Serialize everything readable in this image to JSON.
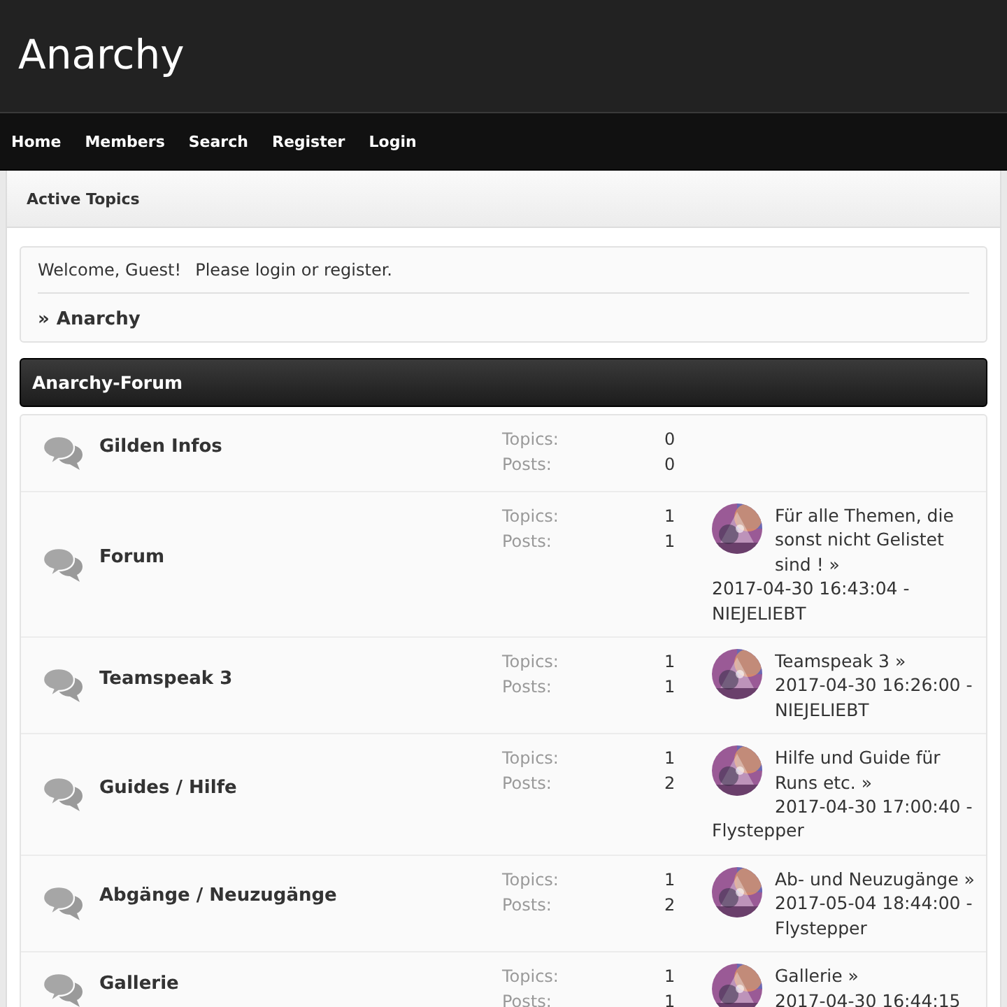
{
  "site_title": "Anarchy",
  "nav": [
    {
      "label": "Home"
    },
    {
      "label": "Members"
    },
    {
      "label": "Search"
    },
    {
      "label": "Register"
    },
    {
      "label": "Login"
    }
  ],
  "subnav": {
    "label": "Active Topics"
  },
  "welcome": {
    "greeting": "Welcome, Guest!",
    "prefix": "Please",
    "login": "login",
    "or": "or",
    "register": "register."
  },
  "breadcrumb": {
    "sep": "»",
    "label": "Anarchy"
  },
  "category": {
    "title": "Anarchy-Forum",
    "forums": [
      {
        "name": "Gilden Infos",
        "topics_label": "Topics:",
        "topics": "0",
        "posts_label": "Posts:",
        "posts": "0"
      },
      {
        "name": "Forum",
        "topics_label": "Topics:",
        "topics": "1",
        "posts_label": "Posts:",
        "posts": "1",
        "last_post": {
          "topic": "Für alle Themen, die sonst nicht Gelistet sind ! »",
          "meta": "2017-04-30 16:43:04 - NIEJELIEBT"
        }
      },
      {
        "name": "Teamspeak 3",
        "topics_label": "Topics:",
        "topics": "1",
        "posts_label": "Posts:",
        "posts": "1",
        "last_post": {
          "topic": "Teamspeak 3 »",
          "meta": "2017-04-30 16:26:00 - NIEJELIEBT"
        }
      },
      {
        "name": "Guides / Hilfe",
        "topics_label": "Topics:",
        "topics": "1",
        "posts_label": "Posts:",
        "posts": "2",
        "last_post": {
          "topic": "Hilfe und Guide für Runs etc. »",
          "meta": "2017-04-30 17:00:40 - Flystepper"
        }
      },
      {
        "name": "Abgänge / Neuzugänge",
        "topics_label": "Topics:",
        "topics": "1",
        "posts_label": "Posts:",
        "posts": "2",
        "last_post": {
          "topic": "Ab- und Neuzugänge »",
          "meta": "2017-05-04 18:44:00 - Flystepper"
        }
      },
      {
        "name": "Gallerie",
        "topics_label": "Topics:",
        "topics": "1",
        "posts_label": "Posts:",
        "posts": "1",
        "last_post": {
          "topic": "Gallerie »",
          "meta": "2017-04-30 16:44:15"
        }
      }
    ]
  }
}
